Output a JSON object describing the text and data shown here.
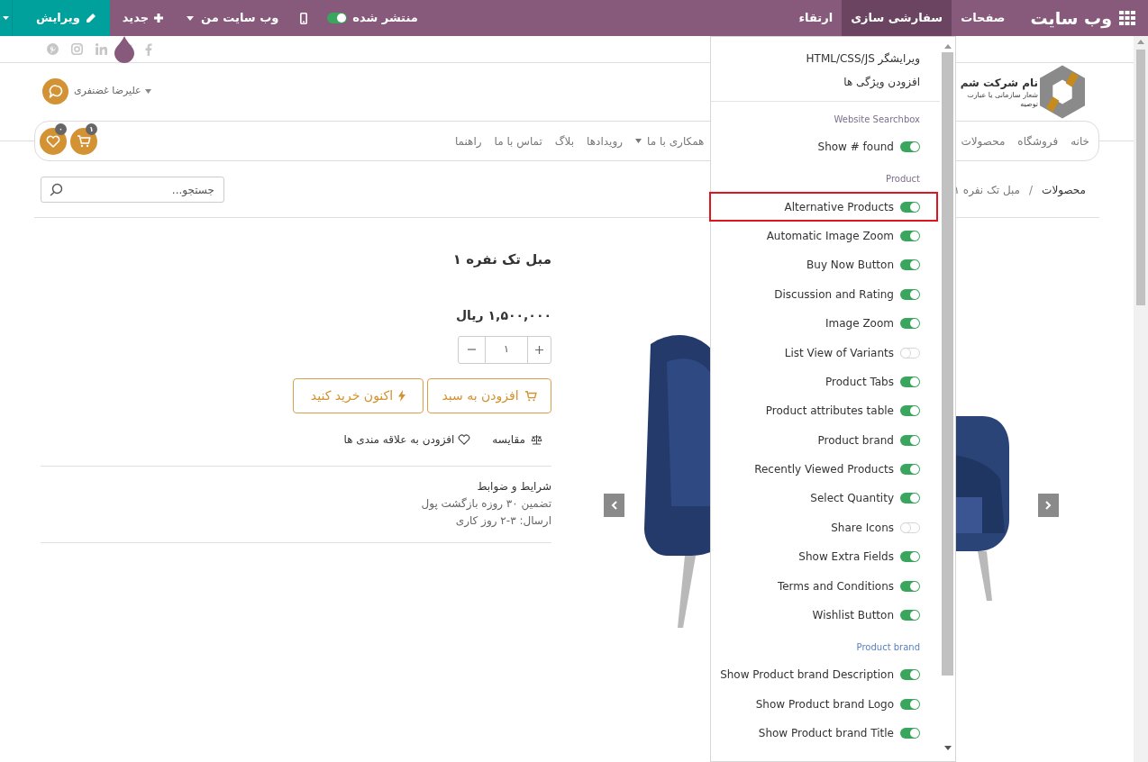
{
  "top_bar": {
    "app_title": "وب سایت",
    "menu": [
      {
        "label": "صفحات",
        "selected": false
      },
      {
        "label": "سفارشی سازی",
        "selected": true
      },
      {
        "label": "ارتقاء",
        "selected": false
      }
    ],
    "published": {
      "label": "منتشر شده",
      "on": true
    },
    "my_website": "وب سایت من",
    "new": "جدید",
    "edit": "ویرایش"
  },
  "header": {
    "company_name": "نام شرکت شم",
    "company_slogan": "شعار سازمانی یا عبارت توصیه",
    "user_name": "علیرضا غضنفری"
  },
  "nav": {
    "items": [
      {
        "label": "خانه",
        "dropdown": false
      },
      {
        "label": "فروشگاه",
        "dropdown": false
      },
      {
        "label": "محصولات",
        "dropdown": false
      },
      {
        "label": "همکاری با ما",
        "dropdown": true
      },
      {
        "label": "رویدادها",
        "dropdown": false
      },
      {
        "label": "بلاگ",
        "dropdown": false
      },
      {
        "label": "تماس با ما",
        "dropdown": false
      },
      {
        "label": "راهنما",
        "dropdown": false
      }
    ],
    "cart_count": "۱",
    "wishlist_count": "۰"
  },
  "search": {
    "placeholder": "جستجو..."
  },
  "breadcrumb": {
    "separator": "/",
    "items": [
      "محصولات",
      "مبل تک نفره ۱"
    ]
  },
  "product": {
    "name": "مبل تک نفره ۱",
    "price": "۱,۵۰۰,۰۰۰ ریال",
    "quantity": "۱",
    "add_to_cart": "افزودن به سبد",
    "buy_now": "اکنون خرید کنید",
    "compare": "مقایسه",
    "wishlist": "افزودن به علاقه مندی ها",
    "terms_title": "شرایط و ضوابط",
    "terms_lines": [
      "تضمین ۳۰ روزه بازگشت پول",
      "ارسال: ۳-۲ روز کاری"
    ],
    "image": {
      "kind": "picture"
    }
  },
  "customize_menu": {
    "links": [
      "ویرایشگر HTML/CSS/JS",
      "افزودن ویژگی ها"
    ],
    "sections": [
      {
        "title": "Website Searchbox",
        "options": [
          {
            "label": "Show # found",
            "on": true,
            "highlighted": false
          }
        ]
      },
      {
        "title": "Product",
        "options": [
          {
            "label": "Alternative Products",
            "on": true,
            "highlighted": true
          },
          {
            "label": "Automatic Image Zoom",
            "on": true,
            "highlighted": false
          },
          {
            "label": "Buy Now Button",
            "on": true,
            "highlighted": false
          },
          {
            "label": "Discussion and Rating",
            "on": true,
            "highlighted": false
          },
          {
            "label": "Image Zoom",
            "on": true,
            "highlighted": false
          },
          {
            "label": "List View of Variants",
            "on": false,
            "highlighted": false
          },
          {
            "label": "Product Tabs",
            "on": true,
            "highlighted": false
          },
          {
            "label": "Product attributes table",
            "on": true,
            "highlighted": false
          },
          {
            "label": "Product brand",
            "on": true,
            "highlighted": false
          },
          {
            "label": "Recently Viewed Products",
            "on": true,
            "highlighted": false
          },
          {
            "label": "Select Quantity",
            "on": true,
            "highlighted": false
          },
          {
            "label": "Share Icons",
            "on": false,
            "highlighted": false
          },
          {
            "label": "Show Extra Fields",
            "on": true,
            "highlighted": false
          },
          {
            "label": "Terms and Conditions",
            "on": true,
            "highlighted": false
          },
          {
            "label": "Wishlist Button",
            "on": true,
            "highlighted": false
          }
        ]
      },
      {
        "title": "Product brand",
        "options": [
          {
            "label": "Show Product brand Description",
            "on": true,
            "highlighted": false
          },
          {
            "label": "Show Product brand Logo",
            "on": true,
            "highlighted": false
          },
          {
            "label": "Show Product brand Title",
            "on": true,
            "highlighted": false
          }
        ]
      }
    ]
  }
}
